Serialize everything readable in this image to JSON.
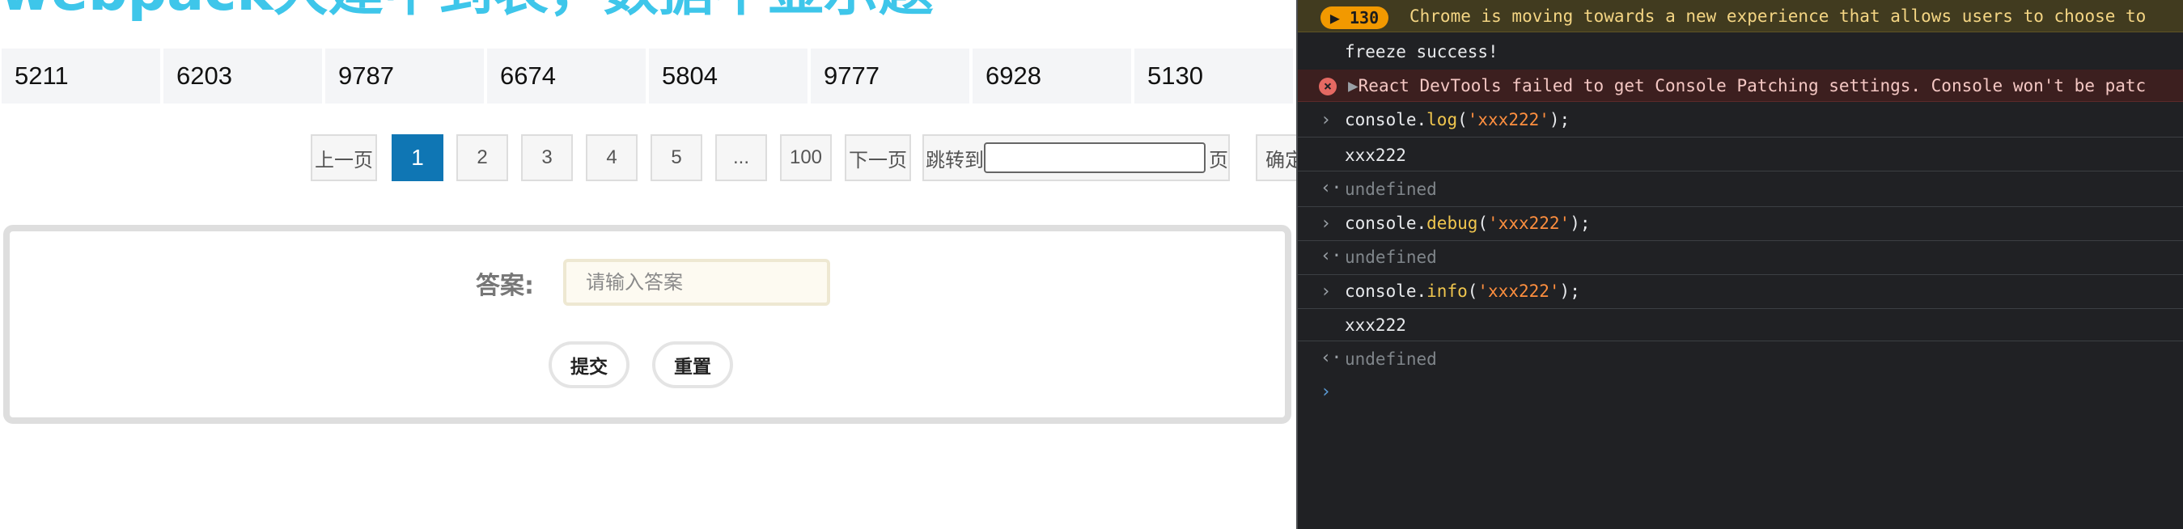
{
  "page": {
    "heading_partial": "webpack大建中到表，数据不显示题"
  },
  "numbers": [
    "5211",
    "6203",
    "9787",
    "6674",
    "5804",
    "9777",
    "6928",
    "5130"
  ],
  "pagination": {
    "prev": "上一页",
    "pages": [
      "1",
      "2",
      "3",
      "4",
      "5",
      "...",
      "100"
    ],
    "active_page": "1",
    "next": "下一页",
    "jump_to_label": "跳转到",
    "jump_suffix": "页",
    "confirm": "确定"
  },
  "form": {
    "answer_label": "答案:",
    "answer_placeholder": "请输入答案",
    "submit": "提交",
    "reset": "重置"
  },
  "devtools": {
    "warning_count": "130",
    "warning_text": "Chrome is moving towards a new experience that allows users to choose to",
    "freeze_text": "freeze success!",
    "error_text": "React DevTools failed to get Console Patching settings. Console won't be patc",
    "log_obj": "console.",
    "log_fn": "log",
    "debug_fn": "debug",
    "info_fn": "info",
    "arg": "'xxx222'",
    "open_paren": "(",
    "close_stmt": ");",
    "output": "xxx222",
    "undefined": "undefined"
  }
}
